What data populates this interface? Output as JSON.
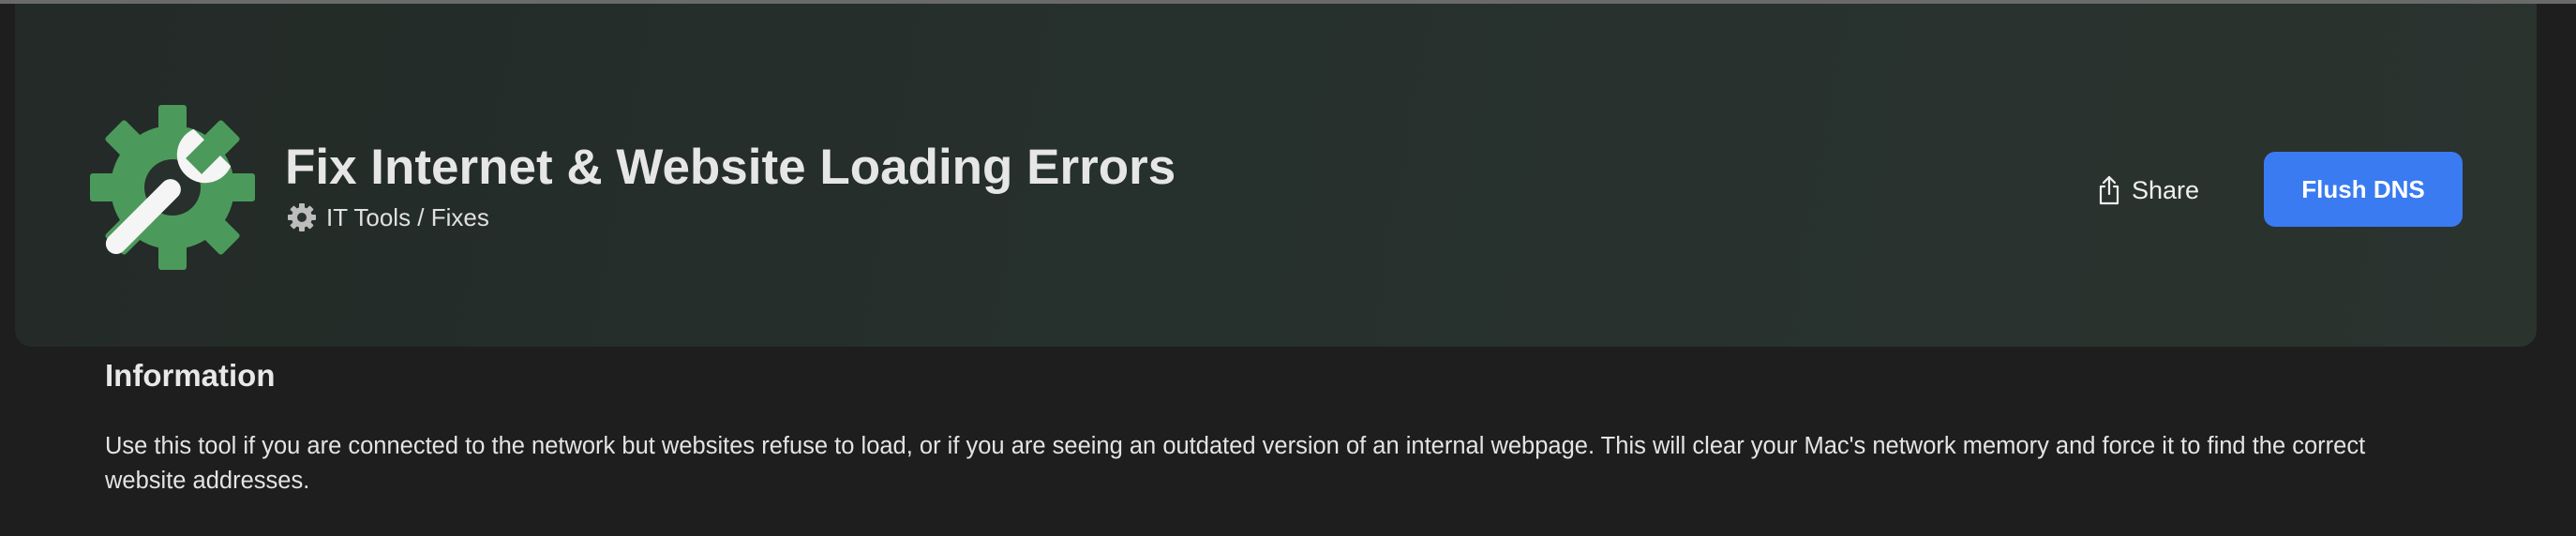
{
  "header": {
    "app_icon": "wrench-gear-icon",
    "title": "Fix Internet & Website Loading Errors",
    "breadcrumb": {
      "icon": "gear-icon",
      "text": "IT Tools / Fixes"
    },
    "share": {
      "icon": "share-icon",
      "label": "Share"
    },
    "primary_action": {
      "label": "Flush DNS"
    }
  },
  "information": {
    "heading": "Information",
    "body": "Use this tool if you are connected to the network but websites refuse to load, or if you are seeing an outdated version of an internal  webpage. This will clear your Mac's network memory and force it to find the correct website addresses."
  },
  "colors": {
    "background": "#1e1e1f",
    "hero_background": "#26302c",
    "accent_button": "#3a7bf1",
    "icon_green": "#4c9a5b",
    "icon_white": "#f5f5f5"
  }
}
